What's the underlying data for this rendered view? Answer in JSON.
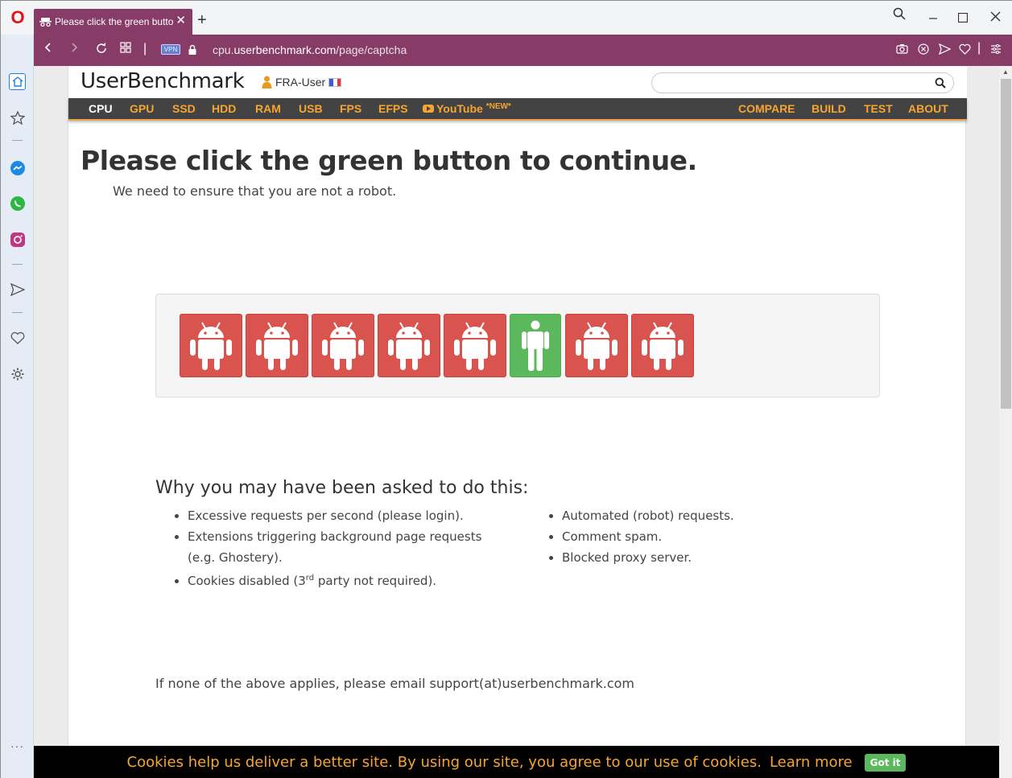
{
  "browser": {
    "tab_title": "Please click the green button",
    "url_prefix": "cpu.",
    "url_domain": "userbenchmark.com",
    "url_path": "/page/captcha",
    "vpn_label": "VPN",
    "sidebar_more": "···"
  },
  "header": {
    "logo": "UserBenchmark",
    "user": "FRA-User",
    "search_placeholder": ""
  },
  "nav": {
    "left": [
      "CPU",
      "GPU",
      "SSD",
      "HDD",
      "RAM",
      "USB",
      "FPS",
      "EFPS"
    ],
    "youtube": "YouTube",
    "youtube_badge": "*NEW*",
    "right": [
      "COMPARE",
      "BUILD",
      "TEST",
      "ABOUT"
    ],
    "active": "CPU"
  },
  "main": {
    "heading": "Please click the green button to continue.",
    "subheading": "We need to ensure that you are not a robot.",
    "captcha_buttons": [
      "android",
      "android",
      "android",
      "android",
      "android",
      "human",
      "android",
      "android"
    ],
    "why_heading": "Why you may have been asked to do this:",
    "reasons_left": [
      "Excessive requests per second (please login).",
      "Extensions triggering background page requests (e.g. Ghostery).",
      "Cookies disabled (3",
      "rd",
      " party not required)."
    ],
    "reasons_right": [
      "Automated (robot) requests.",
      "Comment spam.",
      "Blocked proxy server."
    ],
    "email_text": "If none of the above applies, please email support(at)userbenchmark.com"
  },
  "cookie_bar": {
    "message": "Cookies help us deliver a better site. By using our site, you agree to our use of cookies.",
    "learn_more": "Learn more",
    "button": "Got it"
  },
  "colors": {
    "accent_orange": "#f7a530",
    "browser_purple": "#873c68",
    "captcha_red": "#d9534f",
    "captcha_green": "#5cb85c"
  }
}
